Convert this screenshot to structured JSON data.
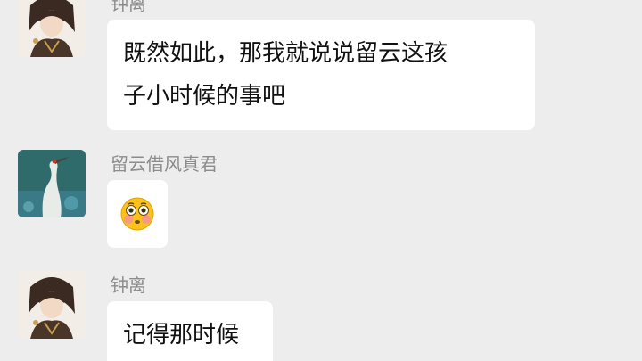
{
  "messages": [
    {
      "sender": "钟离",
      "avatar_icon": "zhongli-avatar-icon",
      "lines": [
        "既然如此，那我就说说留云这孩",
        "子小时候的事吧"
      ]
    },
    {
      "sender": "留云借风真君",
      "avatar_icon": "crane-avatar-icon",
      "emoji": "flushed-face-emoji"
    },
    {
      "sender": "钟离",
      "avatar_icon": "zhongli-avatar-icon",
      "lines": [
        "记得那时候"
      ]
    }
  ],
  "colors": {
    "background": "#ededed",
    "bubble": "#ffffff",
    "sender_name": "#8c8c8c",
    "text": "#111111"
  }
}
